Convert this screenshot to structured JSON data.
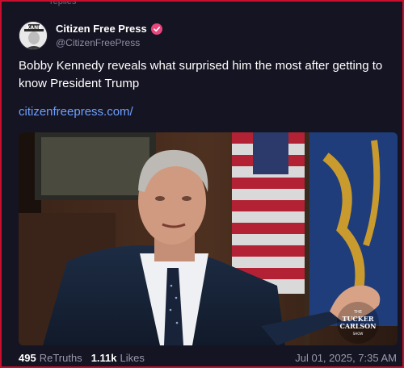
{
  "thread": {
    "previous_replies": "replies"
  },
  "author": {
    "display_name": "Citizen Free Press",
    "handle": "@CitizenFreePress",
    "avatar_text": "KANE",
    "verified_color": "#e8467c"
  },
  "post": {
    "text": "Bobby Kennedy reveals what surprised him the most after getting to know President Trump",
    "link": "citizenfreepress.com/",
    "media": {
      "watermark_line1": "THE",
      "watermark_line2": "TUCKER",
      "watermark_line3": "CARLSON",
      "watermark_line4": "SHOW"
    }
  },
  "stats": {
    "retruths_count": "495",
    "retruths_label": "ReTruths",
    "likes_count": "1.11k",
    "likes_label": "Likes",
    "timestamp": "Jul 01, 2025, 7:35 AM"
  },
  "colors": {
    "background": "#151422",
    "link": "#6ea0ff",
    "muted": "#9a99ad",
    "border": "#c8102e"
  }
}
